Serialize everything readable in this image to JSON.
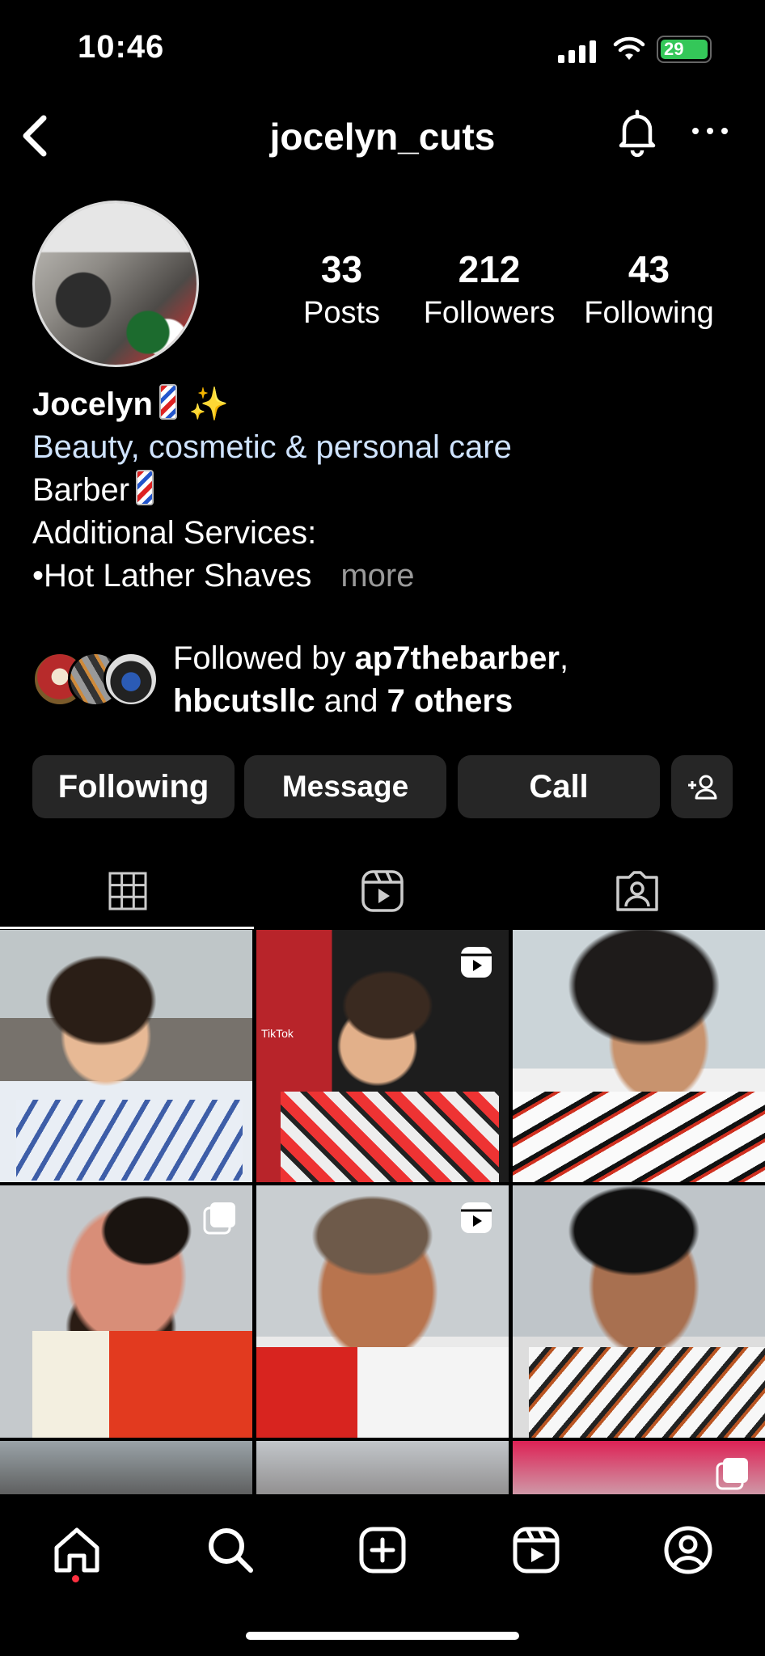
{
  "status_bar": {
    "time": "10:46",
    "battery": "29"
  },
  "header": {
    "username": "jocelyn_cuts"
  },
  "stats": [
    {
      "num": "33",
      "label": "Posts"
    },
    {
      "num": "212",
      "label": "Followers"
    },
    {
      "num": "43",
      "label": "Following"
    }
  ],
  "bio": {
    "name": "Jocelyn",
    "category": "Beauty, cosmetic & personal care",
    "line1": "Barber",
    "line2": "Additional Services:",
    "line3": "•Hot Lather Shaves",
    "more": "more"
  },
  "followed_by": {
    "prefix": "Followed by",
    "user1": "ap7thebarber",
    "user2": "hbcutsllc",
    "and": "and",
    "others": "7 others"
  },
  "buttons": {
    "following": "Following",
    "message": "Message",
    "call": "Call"
  },
  "tabs": [
    "grid",
    "reels",
    "tagged"
  ],
  "grid_badges": {
    "tiktok": "TikTok"
  },
  "colors": {
    "background": "#000000",
    "button_bg": "#262626",
    "category_text": "#cfe3ff",
    "battery": "#34c759",
    "notification_dot": "#ff3040"
  }
}
